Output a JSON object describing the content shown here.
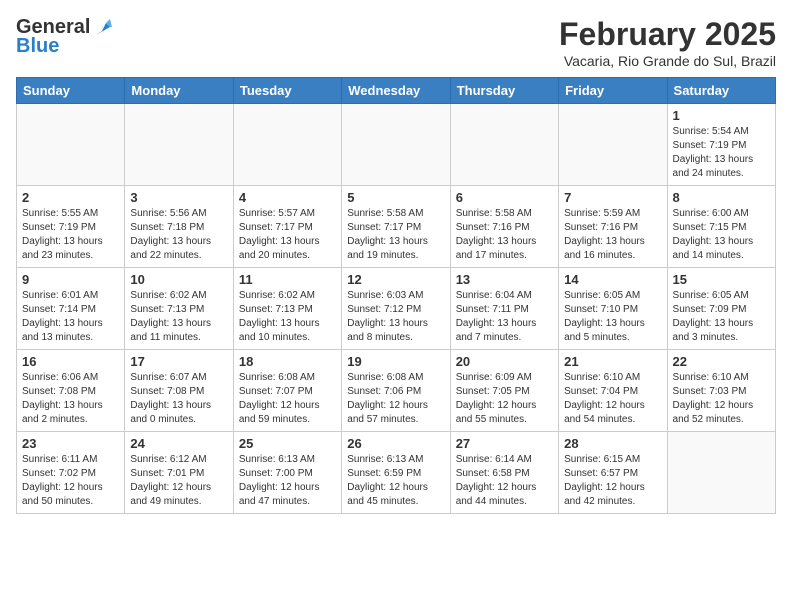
{
  "header": {
    "logo_line1": "General",
    "logo_line2": "Blue",
    "month": "February 2025",
    "location": "Vacaria, Rio Grande do Sul, Brazil"
  },
  "weekdays": [
    "Sunday",
    "Monday",
    "Tuesday",
    "Wednesday",
    "Thursday",
    "Friday",
    "Saturday"
  ],
  "weeks": [
    [
      {
        "day": "",
        "info": ""
      },
      {
        "day": "",
        "info": ""
      },
      {
        "day": "",
        "info": ""
      },
      {
        "day": "",
        "info": ""
      },
      {
        "day": "",
        "info": ""
      },
      {
        "day": "",
        "info": ""
      },
      {
        "day": "1",
        "info": "Sunrise: 5:54 AM\nSunset: 7:19 PM\nDaylight: 13 hours and 24 minutes."
      }
    ],
    [
      {
        "day": "2",
        "info": "Sunrise: 5:55 AM\nSunset: 7:19 PM\nDaylight: 13 hours and 23 minutes."
      },
      {
        "day": "3",
        "info": "Sunrise: 5:56 AM\nSunset: 7:18 PM\nDaylight: 13 hours and 22 minutes."
      },
      {
        "day": "4",
        "info": "Sunrise: 5:57 AM\nSunset: 7:17 PM\nDaylight: 13 hours and 20 minutes."
      },
      {
        "day": "5",
        "info": "Sunrise: 5:58 AM\nSunset: 7:17 PM\nDaylight: 13 hours and 19 minutes."
      },
      {
        "day": "6",
        "info": "Sunrise: 5:58 AM\nSunset: 7:16 PM\nDaylight: 13 hours and 17 minutes."
      },
      {
        "day": "7",
        "info": "Sunrise: 5:59 AM\nSunset: 7:16 PM\nDaylight: 13 hours and 16 minutes."
      },
      {
        "day": "8",
        "info": "Sunrise: 6:00 AM\nSunset: 7:15 PM\nDaylight: 13 hours and 14 minutes."
      }
    ],
    [
      {
        "day": "9",
        "info": "Sunrise: 6:01 AM\nSunset: 7:14 PM\nDaylight: 13 hours and 13 minutes."
      },
      {
        "day": "10",
        "info": "Sunrise: 6:02 AM\nSunset: 7:13 PM\nDaylight: 13 hours and 11 minutes."
      },
      {
        "day": "11",
        "info": "Sunrise: 6:02 AM\nSunset: 7:13 PM\nDaylight: 13 hours and 10 minutes."
      },
      {
        "day": "12",
        "info": "Sunrise: 6:03 AM\nSunset: 7:12 PM\nDaylight: 13 hours and 8 minutes."
      },
      {
        "day": "13",
        "info": "Sunrise: 6:04 AM\nSunset: 7:11 PM\nDaylight: 13 hours and 7 minutes."
      },
      {
        "day": "14",
        "info": "Sunrise: 6:05 AM\nSunset: 7:10 PM\nDaylight: 13 hours and 5 minutes."
      },
      {
        "day": "15",
        "info": "Sunrise: 6:05 AM\nSunset: 7:09 PM\nDaylight: 13 hours and 3 minutes."
      }
    ],
    [
      {
        "day": "16",
        "info": "Sunrise: 6:06 AM\nSunset: 7:08 PM\nDaylight: 13 hours and 2 minutes."
      },
      {
        "day": "17",
        "info": "Sunrise: 6:07 AM\nSunset: 7:08 PM\nDaylight: 13 hours and 0 minutes."
      },
      {
        "day": "18",
        "info": "Sunrise: 6:08 AM\nSunset: 7:07 PM\nDaylight: 12 hours and 59 minutes."
      },
      {
        "day": "19",
        "info": "Sunrise: 6:08 AM\nSunset: 7:06 PM\nDaylight: 12 hours and 57 minutes."
      },
      {
        "day": "20",
        "info": "Sunrise: 6:09 AM\nSunset: 7:05 PM\nDaylight: 12 hours and 55 minutes."
      },
      {
        "day": "21",
        "info": "Sunrise: 6:10 AM\nSunset: 7:04 PM\nDaylight: 12 hours and 54 minutes."
      },
      {
        "day": "22",
        "info": "Sunrise: 6:10 AM\nSunset: 7:03 PM\nDaylight: 12 hours and 52 minutes."
      }
    ],
    [
      {
        "day": "23",
        "info": "Sunrise: 6:11 AM\nSunset: 7:02 PM\nDaylight: 12 hours and 50 minutes."
      },
      {
        "day": "24",
        "info": "Sunrise: 6:12 AM\nSunset: 7:01 PM\nDaylight: 12 hours and 49 minutes."
      },
      {
        "day": "25",
        "info": "Sunrise: 6:13 AM\nSunset: 7:00 PM\nDaylight: 12 hours and 47 minutes."
      },
      {
        "day": "26",
        "info": "Sunrise: 6:13 AM\nSunset: 6:59 PM\nDaylight: 12 hours and 45 minutes."
      },
      {
        "day": "27",
        "info": "Sunrise: 6:14 AM\nSunset: 6:58 PM\nDaylight: 12 hours and 44 minutes."
      },
      {
        "day": "28",
        "info": "Sunrise: 6:15 AM\nSunset: 6:57 PM\nDaylight: 12 hours and 42 minutes."
      },
      {
        "day": "",
        "info": ""
      }
    ]
  ]
}
